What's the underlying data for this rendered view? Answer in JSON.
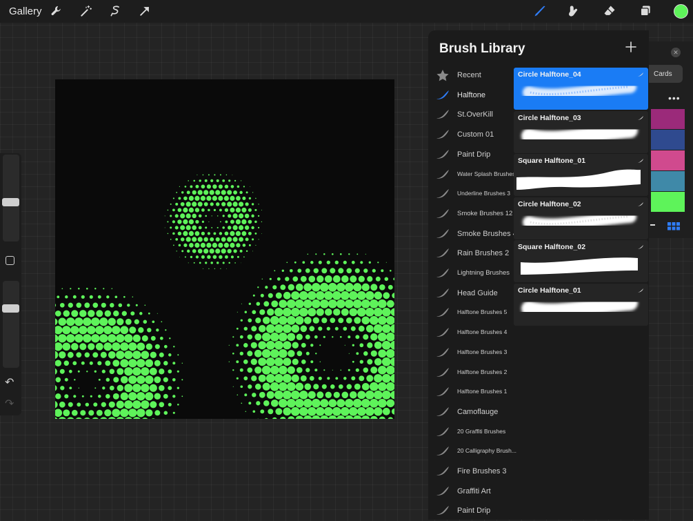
{
  "toolbar": {
    "gallery_label": "Gallery",
    "left_tools": [
      {
        "icon": "wrench-icon"
      },
      {
        "icon": "magic-wand-icon"
      },
      {
        "icon": "selection-icon"
      },
      {
        "icon": "arrow-icon"
      }
    ],
    "right_tools": [
      {
        "icon": "brush-icon",
        "active": true
      },
      {
        "icon": "smudge-icon"
      },
      {
        "icon": "eraser-icon"
      },
      {
        "icon": "layers-icon"
      }
    ],
    "current_color": "#5ef35a"
  },
  "sidebar": {
    "brush_size_level": 0.55,
    "opacity_level": 0.3
  },
  "canvas": {
    "background": "#0a0a0a",
    "dot_color": "#5ef35a"
  },
  "brush_library": {
    "title": "Brush Library",
    "brush_sets": [
      {
        "label": "Recent",
        "icon": "star-icon"
      },
      {
        "label": "Halftone",
        "icon": "brush-stroke-icon",
        "active": true
      },
      {
        "label": "St.OverKill",
        "icon": "brush-stroke-icon"
      },
      {
        "label": "Custom 01",
        "icon": "brush-stroke-icon"
      },
      {
        "label": "Paint Drip",
        "icon": "brush-stroke-icon"
      },
      {
        "label": "Water Splash Brushes",
        "icon": "brush-stroke-icon"
      },
      {
        "label": "Underline Brushes 3",
        "icon": "brush-stroke-icon"
      },
      {
        "label": "Smoke Brushes 12",
        "icon": "brush-stroke-icon"
      },
      {
        "label": "Smoke Brushes 4",
        "icon": "brush-stroke-icon"
      },
      {
        "label": "Rain Brushes 2",
        "icon": "brush-stroke-icon"
      },
      {
        "label": "Lightning Brushes",
        "icon": "brush-stroke-icon"
      },
      {
        "label": "Head Guide",
        "icon": "brush-stroke-icon"
      },
      {
        "label": "Halftone Brushes 5",
        "icon": "brush-stroke-icon"
      },
      {
        "label": "Halftone Brushes 4",
        "icon": "brush-stroke-icon"
      },
      {
        "label": "Halftone Brushes 3",
        "icon": "brush-stroke-icon"
      },
      {
        "label": "Halftone Brushes 2",
        "icon": "brush-stroke-icon"
      },
      {
        "label": "Halftone Brushes 1",
        "icon": "brush-stroke-icon"
      },
      {
        "label": "Camoflauge",
        "icon": "brush-stroke-icon"
      },
      {
        "label": "20 Graffiti Brushes",
        "icon": "brush-stroke-icon"
      },
      {
        "label": "20 Calligraphy Brush...",
        "icon": "brush-stroke-icon"
      },
      {
        "label": "Fire Brushes 3",
        "icon": "brush-stroke-icon"
      },
      {
        "label": "Graffiti Art",
        "icon": "brush-stroke-icon"
      },
      {
        "label": "Paint Drip",
        "icon": "brush-stroke-icon"
      }
    ],
    "brushes": [
      {
        "name": "Circle Halftone_04",
        "selected": true
      },
      {
        "name": "Circle Halftone_03"
      },
      {
        "name": "Square Halftone_01"
      },
      {
        "name": "Circle Halftone_02"
      },
      {
        "name": "Square Halftone_02"
      },
      {
        "name": "Circle Halftone_01"
      }
    ]
  },
  "color_panel": {
    "cards_label": "Cards",
    "swatches": [
      "#9b2a7a",
      "#2f4a8f",
      "#d04a8e",
      "#3f89a8",
      "#5ef35a"
    ]
  }
}
